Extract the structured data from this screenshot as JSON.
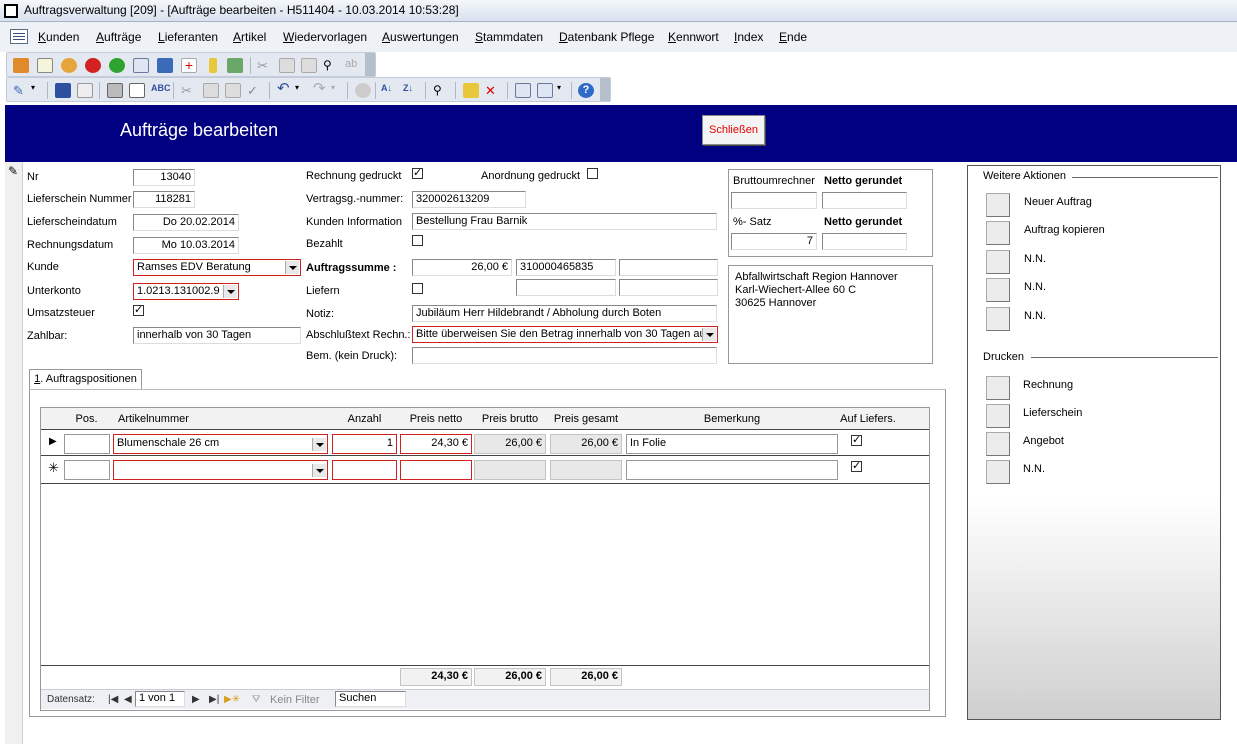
{
  "window": {
    "title": "Auftragsverwaltung [209] - [Aufträge bearbeiten - H511404 - 10.03.2014 10:53:28]"
  },
  "menu": [
    {
      "accel": "K",
      "rest": "unden"
    },
    {
      "accel": "A",
      "rest": "ufträge"
    },
    {
      "accel": "L",
      "rest": "ieferanten"
    },
    {
      "accel": "A",
      "rest": "rtikel"
    },
    {
      "accel": "W",
      "rest": "iedervorlagen"
    },
    {
      "accel": "A",
      "rest": "uswertungen"
    },
    {
      "accel": "S",
      "rest": "tammdaten"
    },
    {
      "accel": "D",
      "rest": "atenbank Pflege"
    },
    {
      "accel": "K",
      "rest": "ennwort"
    },
    {
      "accel": "I",
      "rest": "ndex"
    },
    {
      "accel": "E",
      "rest": "nde"
    }
  ],
  "header": {
    "title": "Aufträge bearbeiten",
    "close_label": "Schließen"
  },
  "form": {
    "nr": {
      "label": "Nr",
      "value": "13040"
    },
    "lieferschein_nr": {
      "label": "Lieferschein Nummer",
      "value": "118281"
    },
    "lieferscheindatum": {
      "label": "Lieferscheindatum",
      "value": "Do 20.02.2014"
    },
    "rechnungsdatum": {
      "label": "Rechnungsdatum",
      "value": "Mo 10.03.2014"
    },
    "kunde": {
      "label": "Kunde",
      "value": "Ramses EDV Beratung"
    },
    "unterkonto": {
      "label": "Unterkonto",
      "value": "1.0213.131002.9"
    },
    "umsatzsteuer": {
      "label": "Umsatzsteuer",
      "checked": true
    },
    "zahlbar": {
      "label": "Zahlbar:",
      "value": "innerhalb von 30 Tagen"
    },
    "rechnung_gedruckt": {
      "label": "Rechnung gedruckt",
      "checked": true
    },
    "anordnung_gedruckt": {
      "label": "Anordnung gedruckt",
      "checked": false
    },
    "vertragsnummer": {
      "label": "Vertragsg.-nummer:",
      "value": "320002613209"
    },
    "kunden_info": {
      "label": "Kunden Information",
      "value": "Bestellung Frau Barnik"
    },
    "bezahlt": {
      "label": "Bezahlt",
      "checked": false
    },
    "auftragssumme": {
      "label": "Auftragssumme :",
      "value": "26,00 €",
      "ref": "310000465835"
    },
    "liefern": {
      "label": "Liefern",
      "checked": false
    },
    "notiz": {
      "label": "Notiz:",
      "value": "Jubiläum Herr Hildebrandt / Abholung durch Boten"
    },
    "abschlusstext": {
      "label": "Abschlußtext Rechn.:",
      "value": "Bitte überweisen Sie den Betrag innerhalb von 30 Tagen au"
    },
    "bemerkung": {
      "label": "Bem. (kein Druck):",
      "value": ""
    }
  },
  "calc": {
    "brutto_label": "Bruttoumrechner",
    "netto_label": "Netto gerundet",
    "satz_label": "%- Satz",
    "netto_label2": "Netto gerundet",
    "satz_value": "7"
  },
  "address": [
    "Abfallwirtschaft Region Hannover",
    "Karl-Wiechert-Allee 60 C",
    "30625 Hannover"
  ],
  "tab": {
    "accel": "1",
    "rest": ". Auftragspositionen"
  },
  "grid": {
    "columns": [
      "Pos.",
      "Artikelnummer",
      "Anzahl",
      "Preis netto",
      "Preis brutto",
      "Preis gesamt",
      "Bemerkung",
      "Auf Liefers."
    ],
    "rows": [
      {
        "pos": "",
        "artikel": "Blumenschale 26 cm",
        "anzahl": "1",
        "netto": "24,30 €",
        "brutto": "26,00 €",
        "gesamt": "26,00 €",
        "bemerkung": "In Folie",
        "auf_liefers": true
      }
    ],
    "totals": {
      "netto": "24,30 €",
      "brutto": "26,00 €",
      "gesamt": "26,00 €"
    }
  },
  "navigator": {
    "label": "Datensatz:",
    "position": "1 von 1",
    "filter": "Kein Filter",
    "search": "Suchen"
  },
  "actions": {
    "title": "Weitere Aktionen",
    "items": [
      "Neuer Auftrag",
      "Auftrag kopieren",
      "N.N.",
      "N.N.",
      "N.N."
    ]
  },
  "print": {
    "title": "Drucken",
    "items": [
      "Rechnung",
      "Lieferschein",
      "Angebot",
      "N.N."
    ]
  }
}
